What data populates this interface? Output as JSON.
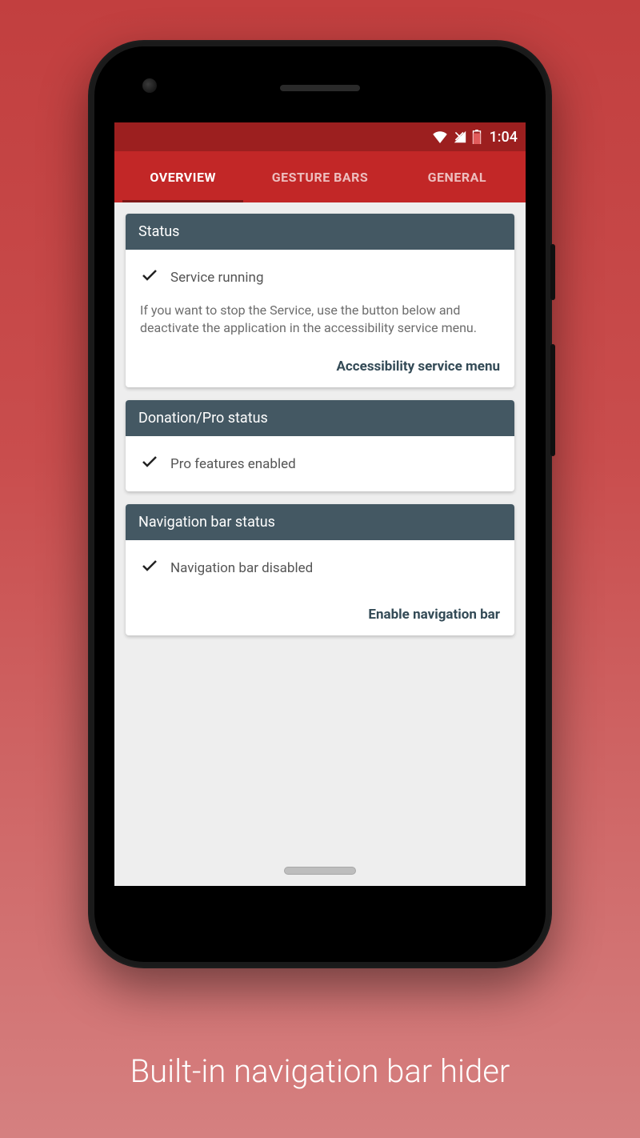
{
  "statusbar": {
    "time": "1:04"
  },
  "tabs": [
    {
      "label": "OVERVIEW",
      "active": true
    },
    {
      "label": "GESTURE BARS",
      "active": false
    },
    {
      "label": "GENERAL",
      "active": false
    }
  ],
  "cards": {
    "status": {
      "header": "Status",
      "row": "Service running",
      "desc": "If you want to stop the Service, use the button below and deactivate the application in the accessibility service menu.",
      "action": "Accessibility service menu"
    },
    "donation": {
      "header": "Donation/Pro status",
      "row": "Pro features enabled"
    },
    "navbar": {
      "header": "Navigation bar status",
      "row": "Navigation bar disabled",
      "action": "Enable navigation bar"
    }
  },
  "caption": "Built-in navigation bar hider"
}
